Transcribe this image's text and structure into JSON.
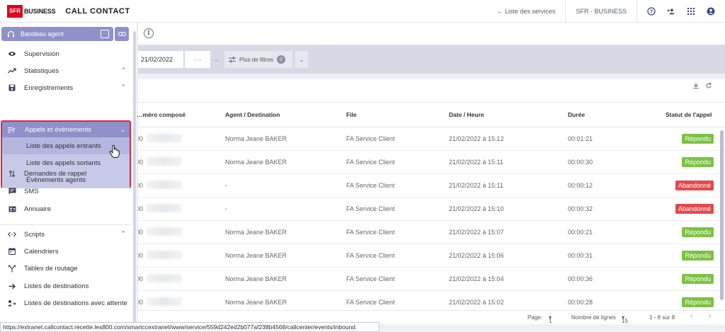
{
  "header": {
    "brand": "SFR",
    "brand_suffix": "BUSINESS",
    "app_title": "CALL CONTACT",
    "services_link": "← Liste des services",
    "account": "SFR - BUSINESS"
  },
  "sidebar": {
    "agent_bar": "Bandeau agent",
    "items_top": [
      {
        "label": "Supervision"
      },
      {
        "label": "Statistiques"
      },
      {
        "label": "Enregistrements"
      }
    ],
    "group": {
      "label": "Appels et évènements",
      "sub_items": [
        {
          "label": "Liste des appels entrants"
        },
        {
          "label": "Liste des appels sortants"
        },
        {
          "label": "Évènements agents"
        }
      ]
    },
    "items_bottom": [
      {
        "label": "Demandes de rappel"
      },
      {
        "label": "SMS"
      },
      {
        "label": "Annuaire"
      },
      {
        "label": "Scripts"
      },
      {
        "label": "Calendriers"
      },
      {
        "label": "Tables de routage"
      },
      {
        "label": "Listes de destinations"
      },
      {
        "label": "Listes de destinations avec attente"
      }
    ]
  },
  "filters": {
    "date": "21/02/2022",
    "time_placeholder": "--:--",
    "more_filters": "Plus de filtres",
    "filter_count": "0"
  },
  "table": {
    "columns": [
      "…méro composé",
      "Agent / Destination",
      "File",
      "Date / Heure",
      "Durée",
      "Statut de l'appel"
    ],
    "rows": [
      {
        "num": "00",
        "agent": "Norma Jeane BAKER",
        "queue": "FA Service Client",
        "datetime": "21/02/2022 à 15:12",
        "duration": "00:01:21",
        "status": "Répondu",
        "status_type": "ok"
      },
      {
        "num": "00",
        "agent": "Norma Jeane BAKER",
        "queue": "FA Service Client",
        "datetime": "21/02/2022 à 15:11",
        "duration": "00:00:30",
        "status": "Répondu",
        "status_type": "ok"
      },
      {
        "num": "00",
        "agent": "-",
        "queue": "FA Service Client",
        "datetime": "21/02/2022 à 15:11",
        "duration": "00:00:12",
        "status": "Abandonné",
        "status_type": "ko"
      },
      {
        "num": "00",
        "agent": "-",
        "queue": "FA Service Client",
        "datetime": "21/02/2022 à 15:10",
        "duration": "00:00:32",
        "status": "Abandonné",
        "status_type": "ko"
      },
      {
        "num": "00",
        "agent": "Norma Jeane BAKER",
        "queue": "FA Service Client",
        "datetime": "21/02/2022 à 15:07",
        "duration": "00:00:21",
        "status": "Répondu",
        "status_type": "ok"
      },
      {
        "num": "00",
        "agent": "Norma Jeane BAKER",
        "queue": "FA Service Client",
        "datetime": "21/02/2022 à 15:06",
        "duration": "00:00:31",
        "status": "Répondu",
        "status_type": "ok"
      },
      {
        "num": "00",
        "agent": "Norma Jeane BAKER",
        "queue": "FA Service Client",
        "datetime": "21/02/2022 à 15:04",
        "duration": "00:00:36",
        "status": "Répondu",
        "status_type": "ok"
      },
      {
        "num": "00",
        "agent": "Norma Jeane BAKER",
        "queue": "FA Service Client",
        "datetime": "21/02/2022 à 15:02",
        "duration": "00:00:28",
        "status": "Répondu",
        "status_type": "ok"
      }
    ]
  },
  "pagination": {
    "page_label": "Page:",
    "page_value": "1",
    "rows_label": "Nombre de lignes",
    "rows_value": "15",
    "range": "1 - 8 sur 8"
  },
  "status_url": "https://extranet.callcontact.recette.les800.com/smartccextranet/www/service/559d242ed2b077af238b4568/callcenter/events/inbound",
  "colors": {
    "brand_red": "#e2001a",
    "accent": "#8f91c8",
    "answered": "#7cc243",
    "abandoned": "#e5484d",
    "highlight_border": "#e5243b"
  }
}
